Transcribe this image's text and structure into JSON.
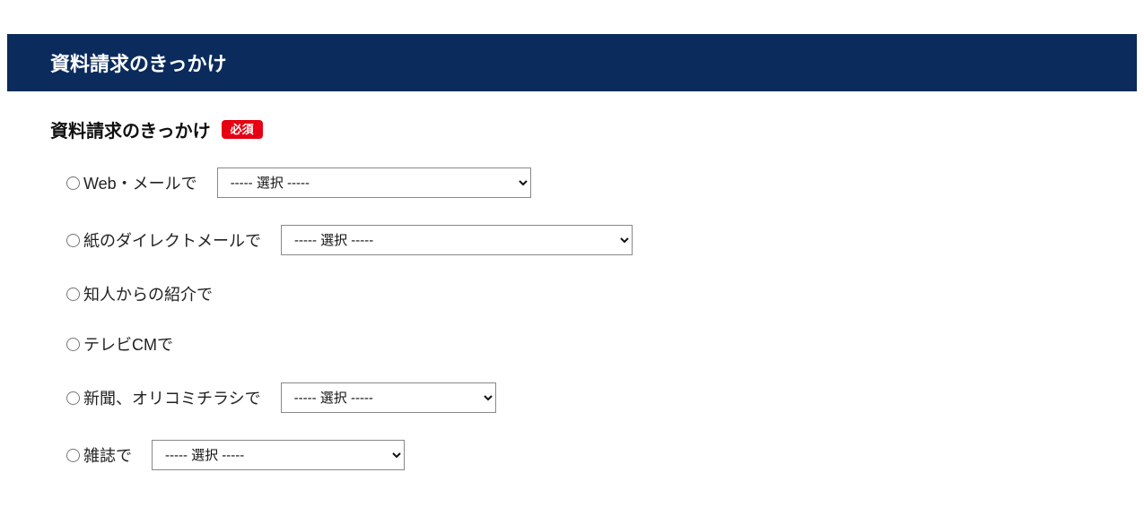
{
  "section": {
    "header": "資料請求のきっかけ",
    "field_title": "資料請求のきっかけ",
    "required_label": "必須"
  },
  "select_placeholder": "----- 選択 -----",
  "options": [
    {
      "label": "Web・メールで",
      "has_select": true,
      "sel_class": "sel-w1"
    },
    {
      "label": "紙のダイレクトメールで",
      "has_select": true,
      "sel_class": "sel-w2"
    },
    {
      "label": "知人からの紹介で",
      "has_select": false
    },
    {
      "label": "テレビCMで",
      "has_select": false
    },
    {
      "label": "新聞、オリコミチラシで",
      "has_select": true,
      "sel_class": "sel-w3"
    },
    {
      "label": "雑誌で",
      "has_select": true,
      "sel_class": "sel-w4"
    }
  ]
}
